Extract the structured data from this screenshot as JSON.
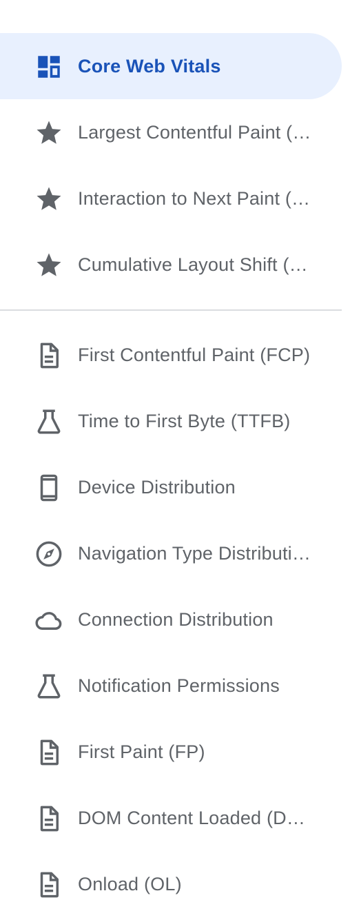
{
  "nav": {
    "primary": [
      {
        "label": "Core Web Vitals",
        "icon": "dashboard-icon",
        "active": true
      },
      {
        "label": "Largest Contentful Paint (LCP)",
        "icon": "star-icon"
      },
      {
        "label": "Interaction to Next Paint (INP)",
        "icon": "star-icon"
      },
      {
        "label": "Cumulative Layout Shift (CLS)",
        "icon": "star-icon"
      }
    ],
    "secondary": [
      {
        "label": "First Contentful Paint (FCP)",
        "icon": "document-icon"
      },
      {
        "label": "Time to First Byte (TTFB)",
        "icon": "flask-icon"
      },
      {
        "label": "Device Distribution",
        "icon": "phone-icon"
      },
      {
        "label": "Navigation Type Distribution",
        "icon": "compass-icon"
      },
      {
        "label": "Connection Distribution",
        "icon": "cloud-icon"
      },
      {
        "label": "Notification Permissions",
        "icon": "flask-icon"
      },
      {
        "label": "First Paint (FP)",
        "icon": "document-icon"
      },
      {
        "label": "DOM Content Loaded (DCL)",
        "icon": "document-icon"
      },
      {
        "label": "Onload (OL)",
        "icon": "document-icon"
      }
    ]
  },
  "colors": {
    "active_bg": "#e8f0fe",
    "active_text": "#1a53b8",
    "text": "#5f6368",
    "icon": "#5f6368",
    "divider": "#dadce0"
  }
}
